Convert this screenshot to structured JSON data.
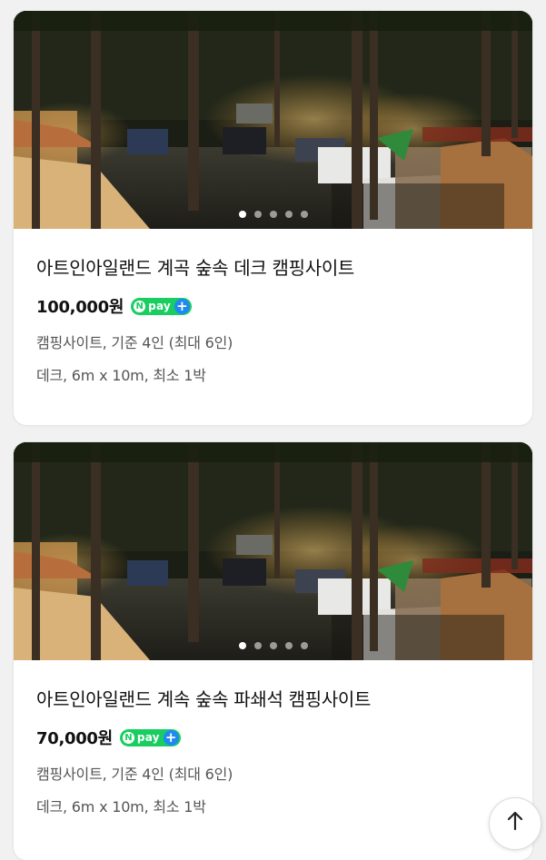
{
  "listings": [
    {
      "title": "아트인아일랜드 계곡 숲속 데크 캠핑사이트",
      "price": "100,000원",
      "npay_badge": "pay",
      "npay_letter": "N",
      "npay_plus": "+",
      "detail_1": "캠핑사이트, 기준 4인 (최대 6인)",
      "detail_2": "데크, 6m x 10m, 최소 1박",
      "photo_dots": 5,
      "active_dot": 0
    },
    {
      "title": "아트인아일랜드 계속 숲속 파쇄석 캠핑사이트",
      "price": "70,000원",
      "npay_badge": "pay",
      "npay_letter": "N",
      "npay_plus": "+",
      "detail_1": "캠핑사이트, 기준 4인 (최대 6인)",
      "detail_2": "데크, 6m x 10m, 최소 1박",
      "photo_dots": 5,
      "active_dot": 0
    }
  ],
  "icons": {
    "scroll_top": "arrow-up-icon",
    "npay": "naver-pay-icon"
  },
  "colors": {
    "npay_green": "#19ce60",
    "npay_plus_blue": "#2187f5"
  }
}
